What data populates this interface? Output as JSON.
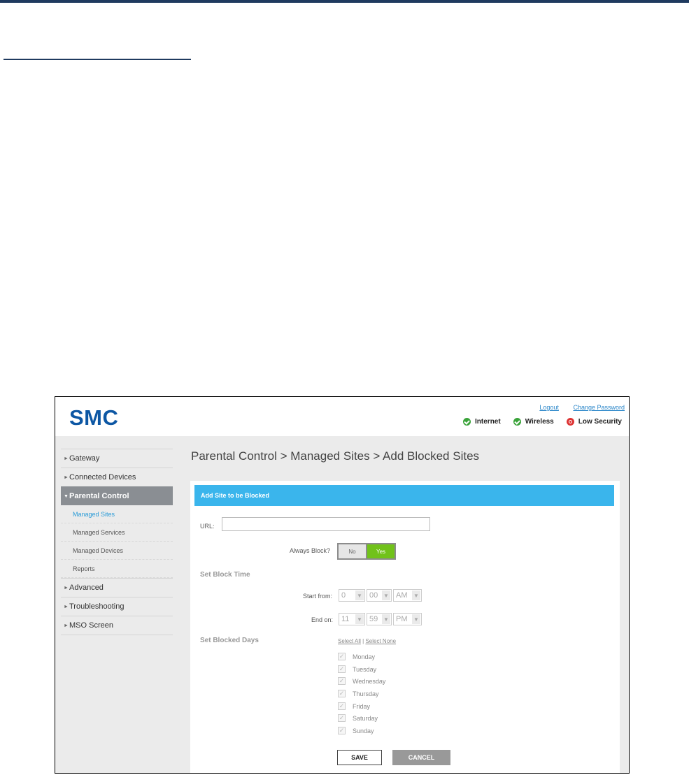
{
  "header": {
    "logo": "SMC",
    "links": {
      "logout": "Logout",
      "change_password": "Change Password"
    },
    "status": [
      {
        "label": "Internet",
        "state": "ok"
      },
      {
        "label": "Wireless",
        "state": "ok"
      },
      {
        "label": "Low Security",
        "state": "warning"
      }
    ]
  },
  "sidebar": {
    "items": [
      {
        "label": "Gateway"
      },
      {
        "label": "Connected Devices"
      },
      {
        "label": "Parental Control",
        "expanded": true
      },
      {
        "label": "Advanced"
      },
      {
        "label": "Troubleshooting"
      },
      {
        "label": "MSO Screen"
      }
    ],
    "subitems": [
      {
        "label": "Managed Sites",
        "current": true
      },
      {
        "label": "Managed Services"
      },
      {
        "label": "Managed Devices"
      },
      {
        "label": "Reports"
      }
    ]
  },
  "main": {
    "title": "Parental Control > Managed Sites > Add Blocked Sites",
    "panel_title": "Add Site to be Blocked",
    "url_label": "URL:",
    "url_value": "",
    "always_block_label": "Always Block?",
    "toggle": {
      "no": "No",
      "yes": "Yes",
      "selected": "Yes"
    },
    "block_time_heading": "Set Block Time",
    "start_label": "Start from:",
    "start": {
      "hour": "0",
      "minute": "00",
      "ampm": "AM"
    },
    "end_label": "End on:",
    "end": {
      "hour": "11",
      "minute": "59",
      "ampm": "PM"
    },
    "blocked_days_heading": "Set Blocked Days",
    "select_all": "Select All",
    "separator": "|",
    "select_none": "Select None",
    "days": [
      "Monday",
      "Tuesday",
      "Wednesday",
      "Thursday",
      "Friday",
      "Saturday",
      "Sunday"
    ],
    "save": "SAVE",
    "cancel": "CANCEL"
  },
  "colors": {
    "brand": "#0d57a4",
    "panel_header": "#3ab5ec",
    "toggle_on": "#71c21a",
    "active_nav": "#8a8e93"
  }
}
